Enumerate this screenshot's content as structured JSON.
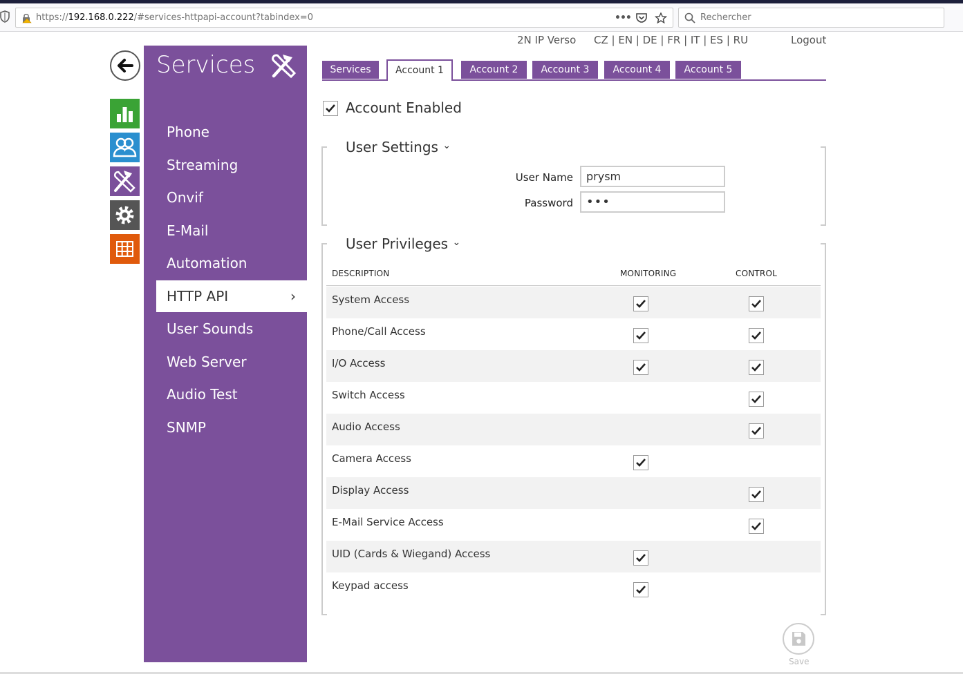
{
  "browser": {
    "url_prefix": "https://",
    "url_host": "192.168.0.222",
    "url_path": "/#services-httpapi-account?tabindex=0",
    "search_placeholder": "Rechercher",
    "more_icon": "•••"
  },
  "topnav": {
    "device": "2N IP Verso",
    "languages": "CZ | EN | DE | FR | IT | ES | RU",
    "logout": "Logout"
  },
  "sidebar": {
    "title": "Services",
    "items": [
      {
        "label": "Phone"
      },
      {
        "label": "Streaming"
      },
      {
        "label": "Onvif"
      },
      {
        "label": "E-Mail"
      },
      {
        "label": "Automation"
      },
      {
        "label": "HTTP API",
        "active": true
      },
      {
        "label": "User Sounds"
      },
      {
        "label": "Web Server"
      },
      {
        "label": "Audio Test"
      },
      {
        "label": "SNMP"
      }
    ],
    "chevron": "›"
  },
  "modules": {
    "colors": {
      "status": "#3aa335",
      "directory": "#2a8fcf",
      "services": "#7b509b",
      "system": "#555555",
      "apps": "#e05a0c"
    }
  },
  "tabs": [
    "Services",
    "Account 1",
    "Account 2",
    "Account 3",
    "Account 4",
    "Account 5"
  ],
  "account": {
    "enabled_label": "Account Enabled",
    "enabled": true
  },
  "user_settings": {
    "title": "User Settings",
    "caret": "⌄",
    "username_label": "User Name",
    "username_value": "prysm",
    "password_label": "Password",
    "password_value": "•••"
  },
  "privileges": {
    "title": "User Privileges",
    "caret": "⌄",
    "col_description": "DESCRIPTION",
    "col_monitoring": "MONITORING",
    "col_control": "CONTROL",
    "rows": [
      {
        "label": "System Access",
        "monitoring": true,
        "control": true
      },
      {
        "label": "Phone/Call Access",
        "monitoring": true,
        "control": true
      },
      {
        "label": "I/O Access",
        "monitoring": true,
        "control": true
      },
      {
        "label": "Switch Access",
        "monitoring": false,
        "control": true
      },
      {
        "label": "Audio Access",
        "monitoring": false,
        "control": true
      },
      {
        "label": "Camera Access",
        "monitoring": true,
        "control": false
      },
      {
        "label": "Display Access",
        "monitoring": false,
        "control": true
      },
      {
        "label": "E-Mail Service Access",
        "monitoring": false,
        "control": true
      },
      {
        "label": "UID (Cards & Wiegand) Access",
        "monitoring": true,
        "control": false
      },
      {
        "label": "Keypad access",
        "monitoring": true,
        "control": false
      }
    ]
  },
  "save_label": "Save",
  "accent": "#7b509b"
}
